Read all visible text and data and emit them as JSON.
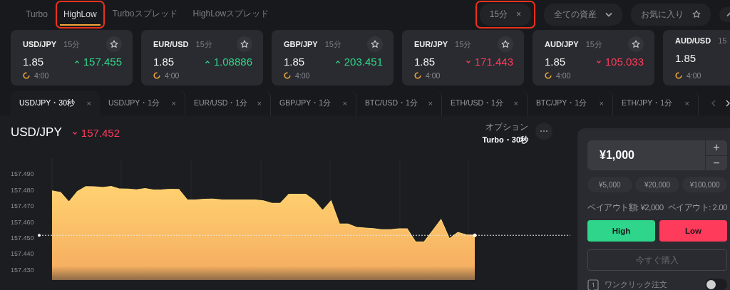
{
  "market_tabs": [
    {
      "label": "Turbo",
      "selected": false,
      "highlighted": false
    },
    {
      "label": "HighLow",
      "selected": true,
      "highlighted": true
    },
    {
      "label": "Turboスプレッド",
      "selected": false,
      "highlighted": false
    },
    {
      "label": "HighLowスプレッド",
      "selected": false,
      "highlighted": false
    }
  ],
  "filters": {
    "duration_chip": {
      "label": "15分",
      "close": "×",
      "highlighted": true
    },
    "asset_dropdown": {
      "label": "全ての資産"
    },
    "favorites": {
      "label": "お気に入り"
    }
  },
  "asset_cards": [
    {
      "pair": "USD/JPY",
      "period": "15分",
      "payout": "1.85",
      "rising": true,
      "price": "157.455",
      "timer": "4:00"
    },
    {
      "pair": "EUR/USD",
      "period": "15分",
      "payout": "1.85",
      "rising": true,
      "price": "1.08886",
      "timer": "4:00"
    },
    {
      "pair": "GBP/JPY",
      "period": "15分",
      "payout": "1.85",
      "rising": true,
      "price": "203.451",
      "timer": "4:00"
    },
    {
      "pair": "EUR/JPY",
      "period": "15分",
      "payout": "1.85",
      "rising": false,
      "price": "171.443",
      "timer": "4:00"
    },
    {
      "pair": "AUD/JPY",
      "period": "15分",
      "payout": "1.85",
      "rising": false,
      "price": "105.033",
      "timer": "4:00"
    },
    {
      "pair": "AUD/USD",
      "period": "15",
      "payout": "1.85",
      "timer": "4:00"
    }
  ],
  "asset_tabs": [
    {
      "label": "USD/JPY・30秒",
      "close": "×",
      "selected": true
    },
    {
      "label": "USD/JPY・1分",
      "close": "×",
      "selected": false
    },
    {
      "label": "EUR/USD・1分",
      "close": "×",
      "selected": false
    },
    {
      "label": "GBP/JPY・1分",
      "close": "×",
      "selected": false
    },
    {
      "label": "BTC/USD・1分",
      "close": "×",
      "selected": false
    },
    {
      "label": "ETH/USD・1分",
      "close": "×",
      "selected": false
    },
    {
      "label": "BTC/JPY・1分",
      "close": "×",
      "selected": false
    },
    {
      "label": "ETH/JPY・1分",
      "close": "×",
      "selected": false
    }
  ],
  "chart_header": {
    "pair": "USD/JPY",
    "rising": false,
    "price": "157.452",
    "option_label": "オプション",
    "option_value": "Turbo・30秒"
  },
  "chart": {
    "chart_data": {
      "type": "area",
      "categories": [
        null,
        null,
        null,
        null,
        null,
        null,
        null,
        null,
        null,
        null,
        null,
        null,
        null,
        null,
        null,
        null,
        null,
        null,
        null,
        null,
        null,
        null,
        null,
        null,
        null,
        null,
        null,
        null,
        null,
        null,
        null,
        null,
        null,
        null,
        null,
        null,
        null,
        null,
        null,
        null,
        null,
        null,
        null,
        null,
        null,
        null,
        null,
        null,
        null,
        null,
        null
      ],
      "series": [
        {
          "color": "#ffd170",
          "values": [
            157.4793,
            157.4783,
            157.4724,
            157.4789,
            157.482,
            157.4819,
            157.4815,
            157.4821,
            157.4805,
            157.4804,
            157.48,
            157.4808,
            157.4799,
            157.48,
            157.4803,
            157.4802,
            157.4736,
            157.4736,
            157.4741,
            157.4742,
            157.4737,
            157.4736,
            157.4736,
            157.4736,
            157.4736,
            157.4731,
            157.4715,
            157.4715,
            157.4772,
            157.4772,
            157.4772,
            157.4734,
            157.467,
            157.4731,
            157.4585,
            157.4585,
            157.4564,
            157.456,
            157.4556,
            157.4549,
            157.4549,
            157.4555,
            157.4555,
            157.4472,
            157.4472,
            157.4541,
            157.4613,
            157.4493,
            157.4532,
            157.4517,
            157.4514
          ]
        }
      ],
      "ylim": [
        157.4233,
        157.4994
      ],
      "yticks": [
        {
          "value": 157.49,
          "label": "157.490"
        },
        {
          "value": 157.48,
          "label": "157.480"
        },
        {
          "value": 157.47,
          "label": "157.470"
        },
        {
          "value": 157.46,
          "label": "157.460"
        },
        {
          "value": 157.45,
          "label": "157.450"
        },
        {
          "value": 157.44,
          "label": "157.440"
        },
        {
          "value": 157.43,
          "label": "157.430"
        }
      ]
    }
  },
  "trade_panel": {
    "amount": "¥1,000",
    "increment": "+",
    "decrement": "−",
    "quick_amounts": [
      "¥5,000",
      "¥20,000",
      "¥100,000"
    ],
    "payout_amount": "ペイアウト額: ¥2,000",
    "payout_rate": "ペイアウト: 2.00",
    "high": "High",
    "low": "Low",
    "buy_now": "今すぐ購入",
    "one_click": {
      "label": "ワンクリック注文",
      "on": false
    }
  }
}
